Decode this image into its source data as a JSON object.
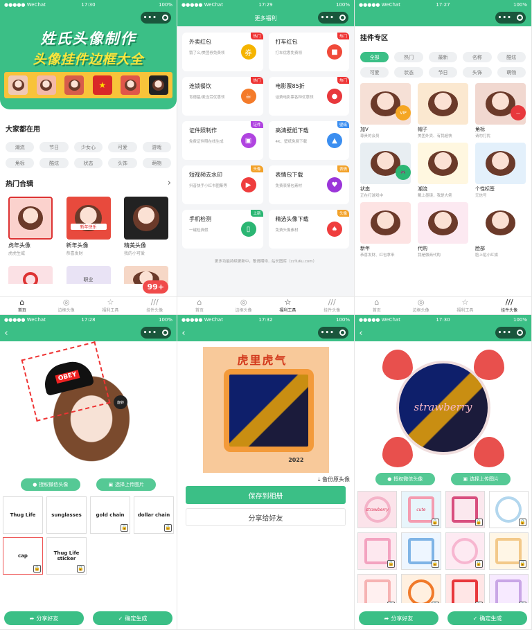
{
  "status": {
    "carrier": "●●●●● WeChat",
    "battery": "100%",
    "times": [
      "17:30",
      "17:29",
      "17:27",
      "17:28",
      "17:32",
      "17:30"
    ]
  },
  "tabbar": [
    {
      "label": "首页",
      "icon": "⌂"
    },
    {
      "label": "边框头像",
      "icon": "◎"
    },
    {
      "label": "福利工具",
      "icon": "☆"
    },
    {
      "label": "挂件头像",
      "icon": "///"
    }
  ],
  "home": {
    "banner_line1": "姓氏头像制作",
    "banner_line2": "头像挂件边框大全",
    "popular_title": "大家都在用",
    "tags": [
      "潮流",
      "节日",
      "少女心",
      "可爱",
      "游戏",
      "角标",
      "酷炫",
      "状态",
      "头饰",
      "萌物"
    ],
    "hot_title": "热门合辑",
    "collections": [
      {
        "name": "虎年头像",
        "desc": "虎虎生威"
      },
      {
        "name": "新年头像",
        "desc": "恭喜发财"
      },
      {
        "name": "精美头像",
        "desc": "我的小可爱"
      }
    ],
    "banner_badge": "新年快乐",
    "badge_count": "99+",
    "row2_label": "职业"
  },
  "welfare": {
    "title": "更多福利",
    "items": [
      {
        "name": "外卖红包",
        "desc": "饿了么/美团券免费领",
        "tag": "热门",
        "tagcolor": "#e33",
        "icon": "券",
        "iconbg": "#f5b400"
      },
      {
        "name": "打车红包",
        "desc": "打车优惠免费领",
        "tag": "热门",
        "tagcolor": "#e33",
        "icon": "■",
        "iconbg": "#f04a3a"
      },
      {
        "name": "连锁餐饮",
        "desc": "肯德基/麦当劳优惠领",
        "tag": "热门",
        "tagcolor": "#e33",
        "icon": "☕",
        "iconbg": "#f47b2a"
      },
      {
        "name": "电影票85折",
        "desc": "话费电影票各种优惠领",
        "tag": "热门",
        "tagcolor": "#e33",
        "icon": "●",
        "iconbg": "#e8383c"
      },
      {
        "name": "证件照制作",
        "desc": "免费证件照在线生成",
        "tag": "证件",
        "tagcolor": "#b044e0",
        "icon": "▣",
        "iconbg": "#b044e0"
      },
      {
        "name": "高清壁纸下载",
        "desc": "4K、壁纸免费下载",
        "tag": "壁纸",
        "tagcolor": "#3b8ef0",
        "icon": "▲",
        "iconbg": "#3b8ef0"
      },
      {
        "name": "短视频去水印",
        "desc": "抖音快手小红书图集等",
        "tag": "头像",
        "tagcolor": "#f2a22a",
        "icon": "▶",
        "iconbg": "#ef3d3d"
      },
      {
        "name": "表情包下载",
        "desc": "免费表情包素材",
        "tag": "表情",
        "tagcolor": "#f2a22a",
        "icon": "♥",
        "iconbg": "#9b35d9"
      },
      {
        "name": "手机检测",
        "desc": "一键检真假",
        "tag": "上新",
        "tagcolor": "#2bb673",
        "icon": "▯",
        "iconbg": "#2bb673"
      },
      {
        "name": "精选头像下载",
        "desc": "免费头像素材",
        "tag": "头像",
        "tagcolor": "#f2a22a",
        "icon": "♠",
        "iconbg": "#ef3d3d"
      }
    ],
    "footer": "更多功能持续更新中，敬请期待...站长图库（zzTuKu.com）"
  },
  "pendant": {
    "title": "挂件专区",
    "filters": [
      "全部",
      "热门",
      "最新",
      "名称",
      "酷炫",
      "可爱",
      "状态",
      "节日",
      "头饰",
      "萌物"
    ],
    "cards": [
      {
        "name": "加V",
        "desc": "尊贵的会员",
        "badge": "VIP",
        "badgecolor": "#f5a623"
      },
      {
        "name": "帽子",
        "desc": "美团外卖、有我超快",
        "badge": "",
        "badgecolor": ""
      },
      {
        "name": "角标",
        "desc": "请勿打扰",
        "badge": "—",
        "badgecolor": "#e8383c"
      },
      {
        "name": "状态",
        "desc": "正在打游戏中",
        "badge": "🎮",
        "badgecolor": "#2bb673"
      },
      {
        "name": "潮流",
        "desc": "戴上墨镜，我是大佬",
        "badge": "",
        "badgecolor": ""
      },
      {
        "name": "个性标签",
        "desc": "无信号",
        "badge": "",
        "badgecolor": ""
      },
      {
        "name": "新年",
        "desc": "恭喜发财、红包拿来",
        "badge": "",
        "badgecolor": ""
      },
      {
        "name": "代购",
        "desc": "我是微商代购",
        "badge": "",
        "badgecolor": ""
      },
      {
        "name": "脸部",
        "desc": "脸上贴小红旗",
        "badge": "",
        "badgecolor": ""
      }
    ],
    "sticker_text": "OBEY",
    "tiger_title": "虎里虎气",
    "tiger_year": "2022",
    "strawberry_text": "strawberry"
  },
  "editor": {
    "auth_btn": "授权微信头像",
    "upload_btn": "选择上传图片",
    "share_btn": "分享好友",
    "confirm_btn": "确定生成",
    "hat_text": "OBEY",
    "flip": "旋转",
    "stickers": [
      "Thug Life",
      "sunglasses",
      "gold chain",
      "dollar chain",
      "cap",
      "Thug Life sticker"
    ]
  },
  "save": {
    "backup_label": "备份原头像",
    "save_btn": "保存到相册",
    "share_btn": "分享给好友"
  },
  "frames": {
    "auth_btn": "授权微信头像",
    "upload_btn": "选择上传图片",
    "share_btn": "分享好友",
    "confirm_btn": "确定生成",
    "frame_labels": [
      "strawberry",
      "cute",
      "",
      "",
      "",
      "",
      "",
      "",
      "",
      "",
      ""
    ]
  },
  "colors": {
    "brand": "#3bbf86",
    "red": "#e8383c"
  }
}
